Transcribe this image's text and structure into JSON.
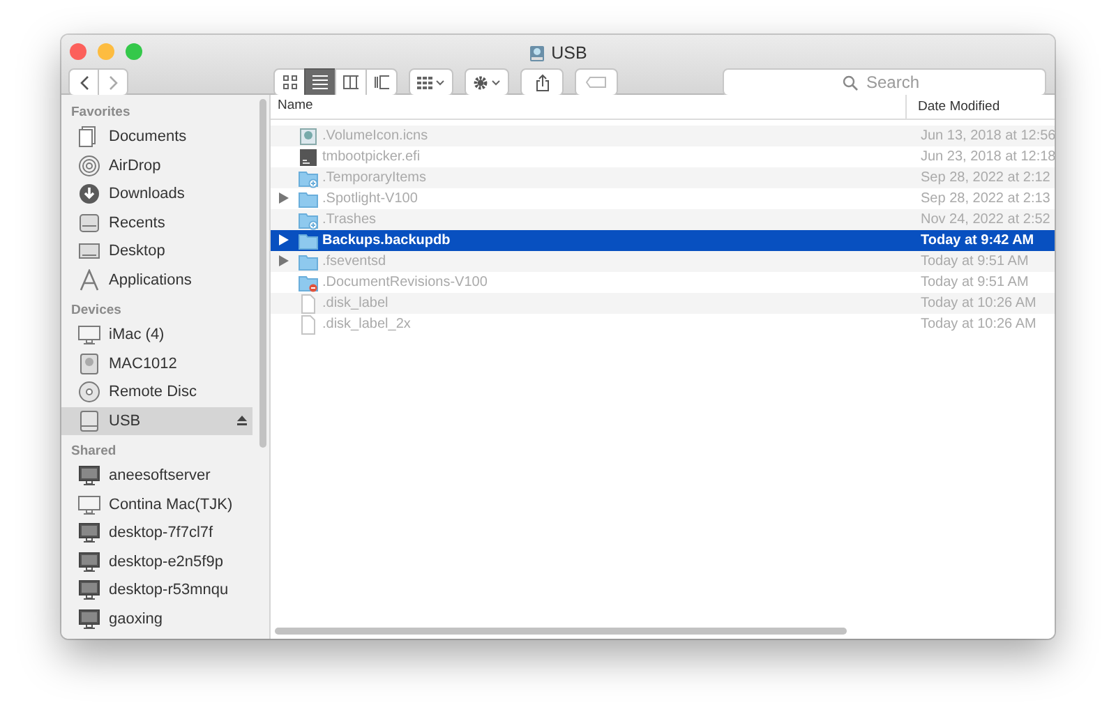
{
  "window": {
    "title": "USB"
  },
  "toolbar": {
    "view_modes": [
      {
        "kind": "icons",
        "selected": false
      },
      {
        "kind": "list",
        "selected": true
      },
      {
        "kind": "columns",
        "selected": false
      },
      {
        "kind": "gallery",
        "selected": false
      }
    ],
    "search": {
      "placeholder": "Search"
    }
  },
  "sidebar": {
    "sections": [
      {
        "title": "Favorites",
        "items": [
          {
            "label": "Documents",
            "kind": "documents",
            "selected": false
          },
          {
            "label": "AirDrop",
            "kind": "airdrop",
            "selected": false
          },
          {
            "label": "Downloads",
            "kind": "downloads",
            "selected": false
          },
          {
            "label": "Recents",
            "kind": "recents",
            "selected": false
          },
          {
            "label": "Desktop",
            "kind": "desktop",
            "selected": false
          },
          {
            "label": "Applications",
            "kind": "applications",
            "selected": false
          }
        ]
      },
      {
        "title": "Devices",
        "items": [
          {
            "label": "iMac (4)",
            "kind": "computer",
            "selected": false
          },
          {
            "label": "MAC1012",
            "kind": "disk",
            "selected": false
          },
          {
            "label": "Remote Disc",
            "kind": "disc",
            "selected": false
          },
          {
            "label": "USB",
            "kind": "drive",
            "selected": true,
            "ejectable": true
          }
        ]
      },
      {
        "title": "Shared",
        "items": [
          {
            "label": "aneesoftserver",
            "kind": "server",
            "selected": false
          },
          {
            "label": "Contina Mac(TJK)",
            "kind": "computer",
            "selected": false
          },
          {
            "label": "desktop-7f7cl7f",
            "kind": "server",
            "selected": false
          },
          {
            "label": "desktop-e2n5f9p",
            "kind": "server",
            "selected": false
          },
          {
            "label": "desktop-r53mnqu",
            "kind": "server",
            "selected": false
          },
          {
            "label": "gaoxing",
            "kind": "server",
            "selected": false
          }
        ]
      }
    ]
  },
  "table": {
    "columns": [
      "Name",
      "Date Modified"
    ],
    "rows": [
      {
        "name": ".VolumeIcon.icns",
        "date": "Jun 13, 2018 at 12:56",
        "kind": "image",
        "expandable": false,
        "dimmed": true,
        "selected": false
      },
      {
        "name": "tmbootpicker.efi",
        "date": "Jun 23, 2018 at 12:18",
        "kind": "exec",
        "expandable": false,
        "dimmed": true,
        "selected": false
      },
      {
        "name": ".TemporaryItems",
        "date": "Sep 28, 2022 at 2:12",
        "kind": "folder-plus",
        "expandable": false,
        "dimmed": true,
        "selected": false
      },
      {
        "name": ".Spotlight-V100",
        "date": "Sep 28, 2022 at 2:13",
        "kind": "folder",
        "expandable": true,
        "dimmed": true,
        "selected": false
      },
      {
        "name": ".Trashes",
        "date": "Nov 24, 2022 at 2:52",
        "kind": "folder-plus",
        "expandable": false,
        "dimmed": true,
        "selected": false
      },
      {
        "name": "Backups.backupdb",
        "date": "Today at 9:42 AM",
        "kind": "folder",
        "expandable": true,
        "dimmed": false,
        "selected": true
      },
      {
        "name": ".fseventsd",
        "date": "Today at 9:51 AM",
        "kind": "folder",
        "expandable": true,
        "dimmed": true,
        "selected": false
      },
      {
        "name": ".DocumentRevisions-V100",
        "date": "Today at 9:51 AM",
        "kind": "folder-lock",
        "expandable": false,
        "dimmed": true,
        "selected": false
      },
      {
        "name": ".disk_label",
        "date": "Today at 10:26 AM",
        "kind": "file",
        "expandable": false,
        "dimmed": true,
        "selected": false
      },
      {
        "name": ".disk_label_2x",
        "date": "Today at 10:26 AM",
        "kind": "file",
        "expandable": false,
        "dimmed": true,
        "selected": false
      }
    ]
  }
}
